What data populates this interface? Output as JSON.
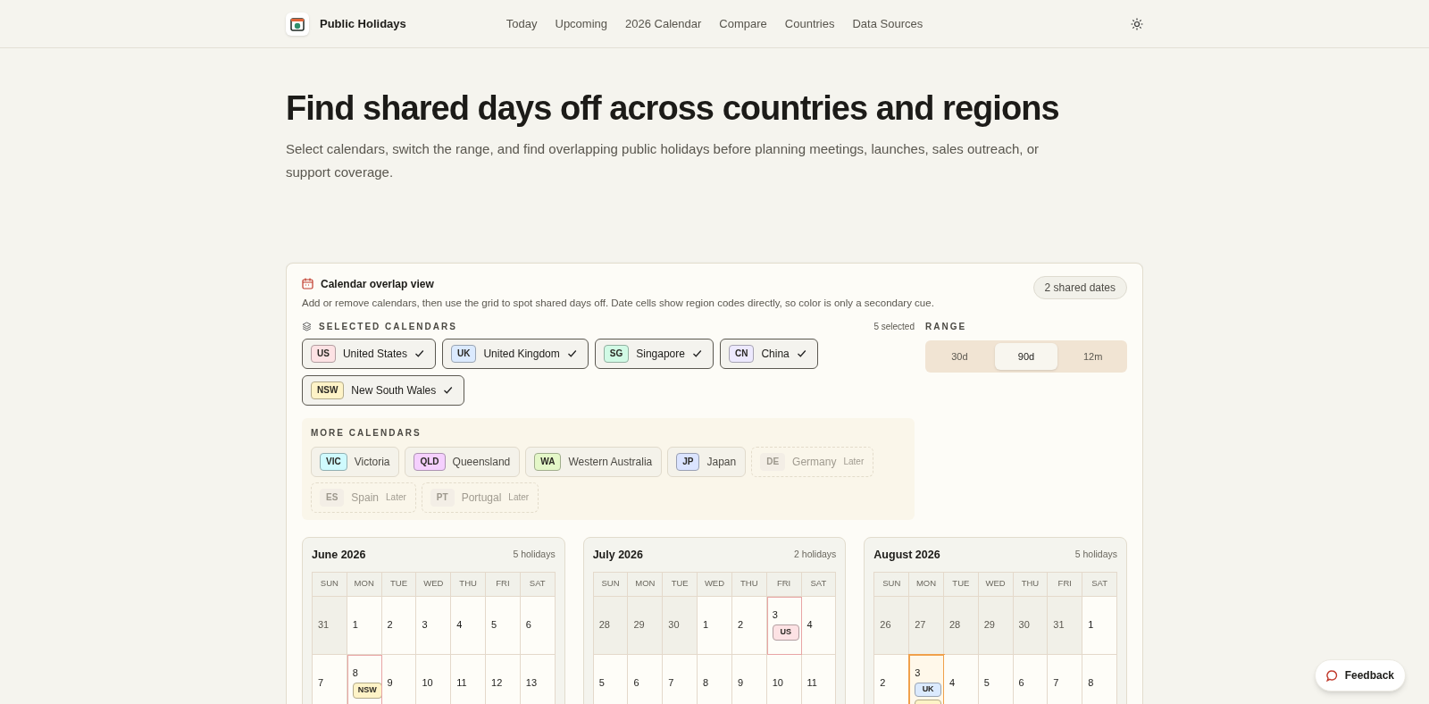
{
  "brand": {
    "name": "Public Holidays"
  },
  "nav": [
    {
      "label": "Today"
    },
    {
      "label": "Upcoming"
    },
    {
      "label": "2026 Calendar"
    },
    {
      "label": "Compare"
    },
    {
      "label": "Countries"
    },
    {
      "label": "Data Sources"
    }
  ],
  "hero": {
    "title": "Find shared days off across countries and regions",
    "subtitle": "Select calendars, switch the range, and find overlapping public holidays before planning meetings, launches, sales outreach, or support coverage."
  },
  "panel": {
    "title": "Calendar overlap view",
    "description": "Add or remove calendars, then use the grid to spot shared days off. Date cells show region codes directly, so color is only a secondary cue.",
    "shared_badge": "2 shared dates",
    "selected_heading": "SELECTED CALENDARS",
    "selected_count": "5 selected",
    "selected": [
      {
        "code": "US",
        "name": "United States",
        "color": "#fde2e4",
        "checked": true
      },
      {
        "code": "UK",
        "name": "United Kingdom",
        "color": "#dbeafe",
        "checked": true
      },
      {
        "code": "SG",
        "name": "Singapore",
        "color": "#d1fae5",
        "checked": true
      },
      {
        "code": "CN",
        "name": "China",
        "color": "#ede9fe",
        "checked": true
      },
      {
        "code": "NSW",
        "name": "New South Wales",
        "color": "#fef3c7",
        "checked": true
      }
    ],
    "range_heading": "RANGE",
    "range": [
      {
        "label": "30d",
        "selected": false
      },
      {
        "label": "90d",
        "selected": true
      },
      {
        "label": "12m",
        "selected": false
      }
    ],
    "more_heading": "MORE CALENDARS",
    "more": [
      {
        "code": "VIC",
        "name": "Victoria",
        "color": "#cffafe",
        "disabled": false
      },
      {
        "code": "QLD",
        "name": "Queensland",
        "color": "#f5d0fe",
        "disabled": false
      },
      {
        "code": "WA",
        "name": "Western Australia",
        "color": "#e4f7c8",
        "disabled": false
      },
      {
        "code": "JP",
        "name": "Japan",
        "color": "#dbe4ff",
        "disabled": false
      },
      {
        "code": "DE",
        "name": "Germany",
        "color": "#f3eee6",
        "disabled": true,
        "note": "Later"
      },
      {
        "code": "ES",
        "name": "Spain",
        "color": "#f3eee6",
        "disabled": true,
        "note": "Later"
      },
      {
        "code": "PT",
        "name": "Portugal",
        "color": "#f3eee6",
        "disabled": true,
        "note": "Later"
      }
    ]
  },
  "months": [
    {
      "title": "June 2026",
      "count": "5 holidays",
      "weekdays": [
        "SUN",
        "MON",
        "TUE",
        "WED",
        "THU",
        "FRI",
        "SAT"
      ],
      "days": [
        {
          "day": "31",
          "outside": true,
          "shared": false
        },
        {
          "day": "1",
          "outside": false,
          "shared": false
        },
        {
          "day": "2",
          "outside": false,
          "shared": false
        },
        {
          "day": "3",
          "outside": false,
          "shared": false
        },
        {
          "day": "4",
          "outside": false,
          "shared": false
        },
        {
          "day": "5",
          "outside": false,
          "shared": false
        },
        {
          "day": "6",
          "outside": false,
          "shared": false
        },
        {
          "day": "7",
          "outside": false,
          "shared": false
        },
        {
          "day": "8",
          "outside": false,
          "shared": false,
          "holidays": [
            {
              "code": "NSW",
              "color": "#fef3c7"
            }
          ]
        },
        {
          "day": "9",
          "outside": false,
          "shared": false
        },
        {
          "day": "10",
          "outside": false,
          "shared": false
        },
        {
          "day": "11",
          "outside": false,
          "shared": false
        },
        {
          "day": "12",
          "outside": false,
          "shared": false
        },
        {
          "day": "13",
          "outside": false,
          "shared": false
        }
      ]
    },
    {
      "title": "July 2026",
      "count": "2 holidays",
      "weekdays": [
        "SUN",
        "MON",
        "TUE",
        "WED",
        "THU",
        "FRI",
        "SAT"
      ],
      "days": [
        {
          "day": "28",
          "outside": true,
          "shared": false
        },
        {
          "day": "29",
          "outside": true,
          "shared": false
        },
        {
          "day": "30",
          "outside": true,
          "shared": false
        },
        {
          "day": "1",
          "outside": false,
          "shared": false
        },
        {
          "day": "2",
          "outside": false,
          "shared": false
        },
        {
          "day": "3",
          "outside": false,
          "shared": false,
          "holidays": [
            {
              "code": "US",
              "color": "#fde2e4"
            }
          ]
        },
        {
          "day": "4",
          "outside": false,
          "shared": false
        },
        {
          "day": "5",
          "outside": false,
          "shared": false
        },
        {
          "day": "6",
          "outside": false,
          "shared": false
        },
        {
          "day": "7",
          "outside": false,
          "shared": false
        },
        {
          "day": "8",
          "outside": false,
          "shared": false
        },
        {
          "day": "9",
          "outside": false,
          "shared": false
        },
        {
          "day": "10",
          "outside": false,
          "shared": false
        },
        {
          "day": "11",
          "outside": false,
          "shared": false
        }
      ]
    },
    {
      "title": "August 2026",
      "count": "5 holidays",
      "weekdays": [
        "SUN",
        "MON",
        "TUE",
        "WED",
        "THU",
        "FRI",
        "SAT"
      ],
      "days": [
        {
          "day": "26",
          "outside": true,
          "shared": false
        },
        {
          "day": "27",
          "outside": true,
          "shared": false
        },
        {
          "day": "28",
          "outside": true,
          "shared": false
        },
        {
          "day": "29",
          "outside": true,
          "shared": false
        },
        {
          "day": "30",
          "outside": true,
          "shared": false
        },
        {
          "day": "31",
          "outside": true,
          "shared": false
        },
        {
          "day": "1",
          "outside": false,
          "shared": false
        },
        {
          "day": "2",
          "outside": false,
          "shared": false
        },
        {
          "day": "3",
          "outside": false,
          "shared": true,
          "holidays": [
            {
              "code": "UK",
              "color": "#dbeafe"
            },
            {
              "color": "#fef3c7"
            }
          ]
        },
        {
          "day": "4",
          "outside": false,
          "shared": false
        },
        {
          "day": "5",
          "outside": false,
          "shared": false
        },
        {
          "day": "6",
          "outside": false,
          "shared": false
        },
        {
          "day": "7",
          "outside": false,
          "shared": false
        },
        {
          "day": "8",
          "outside": false,
          "shared": false
        }
      ]
    }
  ],
  "feedback": {
    "label": "Feedback"
  }
}
